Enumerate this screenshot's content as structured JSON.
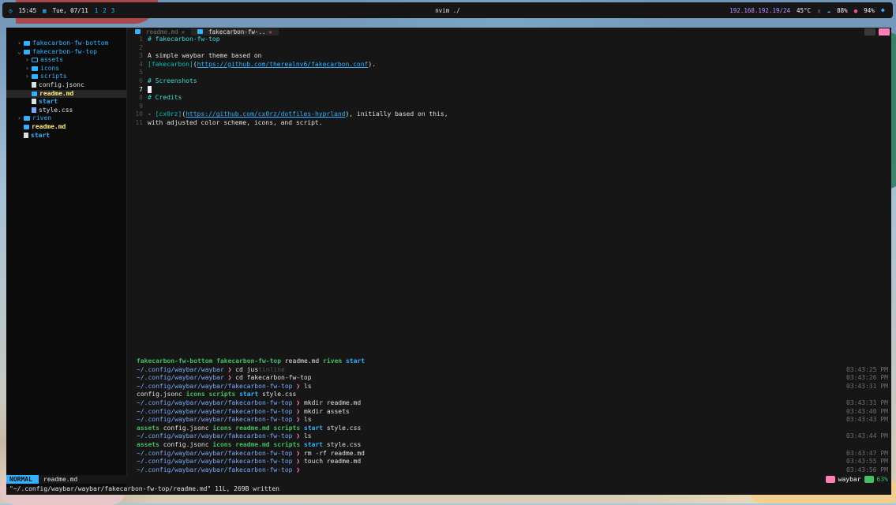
{
  "waybar": {
    "time": "15:45",
    "date": "Tue, 07/11",
    "workspaces": [
      "1",
      "2",
      "3"
    ],
    "title": "nvim ./",
    "ip": "192.168.192.19/24",
    "temp": "45°C",
    "cpu": "88%",
    "mic": "94%"
  },
  "tree": [
    {
      "label": "fakecarbon-fw-bottom",
      "kind": "dir",
      "chev": "›",
      "indent": 0
    },
    {
      "label": "fakecarbon-fw-top",
      "kind": "dir-open",
      "chev": "⌄",
      "indent": 0
    },
    {
      "label": "assets",
      "kind": "dir-empty",
      "chev": "›",
      "indent": 1
    },
    {
      "label": "icons",
      "kind": "dir",
      "chev": "›",
      "indent": 1
    },
    {
      "label": "scripts",
      "kind": "dir",
      "chev": "›",
      "indent": 1
    },
    {
      "label": "config.jsonc",
      "kind": "file",
      "chev": "",
      "indent": 1
    },
    {
      "label": "readme.md",
      "kind": "md",
      "chev": "",
      "indent": 1,
      "selected": true
    },
    {
      "label": "start",
      "kind": "exec",
      "chev": "",
      "indent": 1
    },
    {
      "label": "style.css",
      "kind": "css",
      "chev": "",
      "indent": 1
    },
    {
      "label": "riven",
      "kind": "dir",
      "chev": "›",
      "indent": 0
    },
    {
      "label": "readme.md",
      "kind": "md",
      "chev": "",
      "indent": 0
    },
    {
      "label": "start",
      "kind": "exec",
      "chev": "",
      "indent": 0
    }
  ],
  "tabs": [
    {
      "label": "readme.md",
      "active": false
    },
    {
      "label": "fakecarbon-fw-..",
      "active": true
    }
  ],
  "editor_lines": [
    {
      "n": "1",
      "parts": [
        {
          "t": "# fakecarbon-fw-top",
          "c": "h"
        }
      ]
    },
    {
      "n": "2",
      "parts": []
    },
    {
      "n": "3",
      "parts": [
        {
          "t": "A simple waybar theme based on",
          "c": "txt"
        }
      ]
    },
    {
      "n": "4",
      "parts": [
        {
          "t": "[fakecarbon]",
          "c": "br"
        },
        {
          "t": "(",
          "c": "txt"
        },
        {
          "t": "https://github.com/therealnv6/fakecarbon.conf",
          "c": "link"
        },
        {
          "t": ").",
          "c": "txt"
        }
      ]
    },
    {
      "n": "5",
      "parts": []
    },
    {
      "n": "6",
      "parts": [
        {
          "t": "# Screenshots",
          "c": "h"
        }
      ]
    },
    {
      "n": "7",
      "parts": [],
      "current": true
    },
    {
      "n": "8",
      "parts": [
        {
          "t": "# Credits",
          "c": "h"
        }
      ]
    },
    {
      "n": "9",
      "parts": []
    },
    {
      "n": "10",
      "parts": [
        {
          "t": "- ",
          "c": "txt"
        },
        {
          "t": "[cx0rz]",
          "c": "br"
        },
        {
          "t": "(",
          "c": "txt"
        },
        {
          "t": "https://github.com/cx0rz/dotfiles-hyprland",
          "c": "link"
        },
        {
          "t": "), initially based on this,",
          "c": "txt"
        }
      ]
    },
    {
      "n": "11",
      "parts": [
        {
          "t": "  with adjusted color scheme, icons, and script.",
          "c": "txt"
        }
      ]
    }
  ],
  "terminal": [
    {
      "parts": [
        {
          "t": "fakecarbon-fw-bottom",
          "c": "dirg"
        },
        {
          "t": "  ",
          "c": "txt"
        },
        {
          "t": "fakecarbon-fw-top",
          "c": "dirg"
        },
        {
          "t": "  readme.md  ",
          "c": "txt"
        },
        {
          "t": "riven",
          "c": "dirg"
        },
        {
          "t": "  ",
          "c": "txt"
        },
        {
          "t": "start",
          "c": "dirb"
        }
      ],
      "ts": ""
    },
    {
      "parts": [
        {
          "t": "~/.config/waybar/waybar ",
          "c": "p"
        },
        {
          "t": "❯ ",
          "c": "g"
        },
        {
          "t": "cd jus",
          "c": "txt"
        },
        {
          "t": "tinline",
          "c": "dim"
        }
      ],
      "ts": "03:43:25 PM"
    },
    {
      "parts": [
        {
          "t": "~/.config/waybar/waybar ",
          "c": "p"
        },
        {
          "t": "❯ ",
          "c": "g"
        },
        {
          "t": "cd fakecarbon-fw-top",
          "c": "txt"
        }
      ],
      "ts": "03:43:26 PM"
    },
    {
      "parts": [
        {
          "t": "~/.config/waybar/waybar/fakecarbon-fw-top ",
          "c": "p"
        },
        {
          "t": "❯ ",
          "c": "g"
        },
        {
          "t": "ls",
          "c": "txt"
        }
      ],
      "ts": "03:43:31 PM"
    },
    {
      "parts": [
        {
          "t": "config.jsonc  ",
          "c": "txt"
        },
        {
          "t": "icons",
          "c": "dirg"
        },
        {
          "t": "  ",
          "c": "txt"
        },
        {
          "t": "scripts",
          "c": "dirg"
        },
        {
          "t": "  ",
          "c": "txt"
        },
        {
          "t": "start",
          "c": "dirb"
        },
        {
          "t": "  style.css",
          "c": "txt"
        }
      ],
      "ts": ""
    },
    {
      "parts": [
        {
          "t": "~/.config/waybar/waybar/fakecarbon-fw-top ",
          "c": "p"
        },
        {
          "t": "❯ ",
          "c": "g"
        },
        {
          "t": "mkdir readme.md",
          "c": "txt"
        }
      ],
      "ts": "03:43:31 PM"
    },
    {
      "parts": [
        {
          "t": "~/.config/waybar/waybar/fakecarbon-fw-top ",
          "c": "p"
        },
        {
          "t": "❯ ",
          "c": "g"
        },
        {
          "t": "mkdir assets",
          "c": "txt"
        }
      ],
      "ts": "03:43:40 PM"
    },
    {
      "parts": [
        {
          "t": "~/.config/waybar/waybar/fakecarbon-fw-top ",
          "c": "p"
        },
        {
          "t": "❯ ",
          "c": "g"
        },
        {
          "t": "ls",
          "c": "txt"
        }
      ],
      "ts": "03:43:43 PM"
    },
    {
      "parts": [
        {
          "t": "assets",
          "c": "dirg"
        },
        {
          "t": "  config.jsonc  ",
          "c": "txt"
        },
        {
          "t": "icons",
          "c": "dirg"
        },
        {
          "t": "  ",
          "c": "txt"
        },
        {
          "t": "readme.md",
          "c": "dirg"
        },
        {
          "t": "  ",
          "c": "txt"
        },
        {
          "t": "scripts",
          "c": "dirg"
        },
        {
          "t": "  ",
          "c": "txt"
        },
        {
          "t": "start",
          "c": "dirb"
        },
        {
          "t": "  style.css",
          "c": "txt"
        }
      ],
      "ts": ""
    },
    {
      "parts": [
        {
          "t": "~/.config/waybar/waybar/fakecarbon-fw-top ",
          "c": "p"
        },
        {
          "t": "❯ ",
          "c": "g"
        },
        {
          "t": "ls",
          "c": "txt"
        }
      ],
      "ts": "03:43:44 PM"
    },
    {
      "parts": [
        {
          "t": "assets",
          "c": "dirg"
        },
        {
          "t": "  config.jsonc  ",
          "c": "txt"
        },
        {
          "t": "icons",
          "c": "dirg"
        },
        {
          "t": "  ",
          "c": "txt"
        },
        {
          "t": "readme.md",
          "c": "dirg"
        },
        {
          "t": "  ",
          "c": "txt"
        },
        {
          "t": "scripts",
          "c": "dirg"
        },
        {
          "t": "  ",
          "c": "txt"
        },
        {
          "t": "start",
          "c": "dirb"
        },
        {
          "t": "  style.css",
          "c": "txt"
        }
      ],
      "ts": ""
    },
    {
      "parts": [
        {
          "t": "~/.config/waybar/waybar/fakecarbon-fw-top ",
          "c": "p"
        },
        {
          "t": "❯ ",
          "c": "g"
        },
        {
          "t": "rm -rf readme.md",
          "c": "txt"
        }
      ],
      "ts": "03:43:47 PM"
    },
    {
      "parts": [
        {
          "t": "~/.config/waybar/waybar/fakecarbon-fw-top ",
          "c": "p"
        },
        {
          "t": "❯ ",
          "c": "g"
        },
        {
          "t": "touch readme.md",
          "c": "txt"
        }
      ],
      "ts": "03:43:55 PM"
    },
    {
      "parts": [
        {
          "t": "~/.config/waybar/waybar/fakecarbon-fw-top ",
          "c": "p"
        },
        {
          "t": "❯",
          "c": "g"
        }
      ],
      "ts": "03:43:56 PM"
    }
  ],
  "statusline": {
    "mode": "NORMAL",
    "file": "readme.md",
    "project": "waybar",
    "percent": "63%"
  },
  "cmdline": "\"~/.config/waybar/waybar/fakecarbon-fw-top/readme.md\" 11L, 269B written"
}
